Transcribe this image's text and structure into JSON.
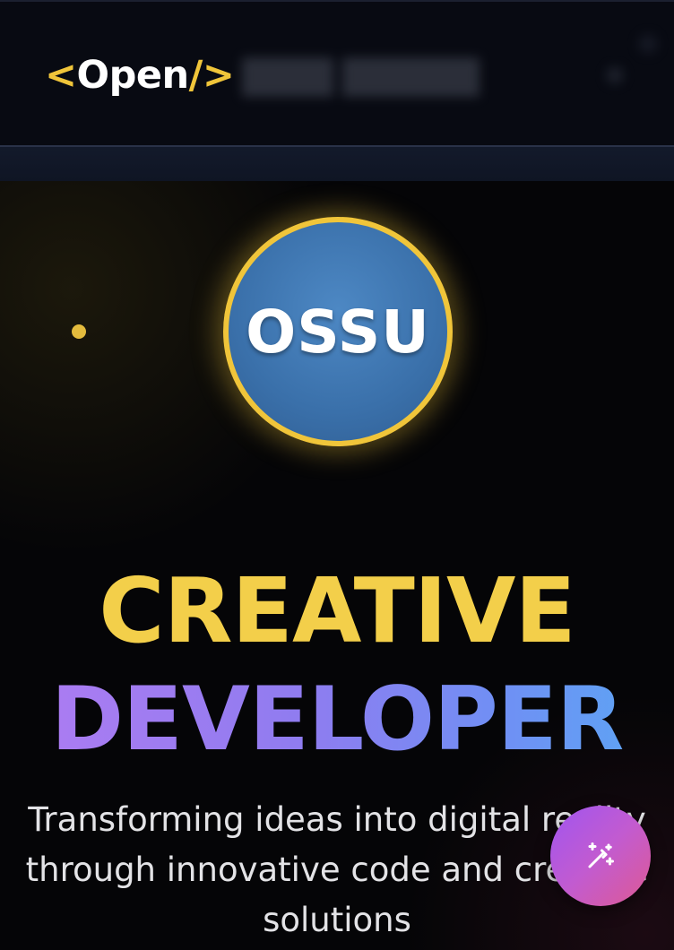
{
  "header": {
    "logo": {
      "open_bracket": "<",
      "word": "Open",
      "close": "/>"
    },
    "icons": [
      "magic-wand-icon"
    ]
  },
  "hero": {
    "badge_text": "OSSU",
    "title_line_1": "CREATIVE",
    "title_line_2": "DEVELOPER",
    "subtitle": "Transforming ideas into digital reality through innovative code and creative solutions"
  },
  "colors": {
    "accent_yellow": "#f0c53a",
    "title_gradient_start": "#b07cf2",
    "title_gradient_end": "#5aa8f3",
    "badge_blue": "#3a70aa",
    "fab_gradient_start": "#a055f0",
    "fab_gradient_end": "#de5a93",
    "background": "#05060a"
  }
}
